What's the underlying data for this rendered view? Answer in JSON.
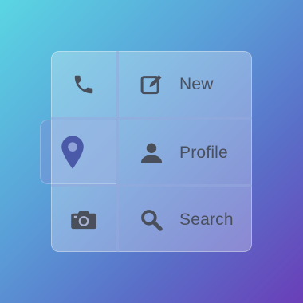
{
  "menu": {
    "items": [
      {
        "icon": "pencil-square-icon",
        "label": "New"
      },
      {
        "icon": "user-icon",
        "label": "Profile"
      },
      {
        "icon": "magnifier-icon",
        "label": "Search"
      }
    ],
    "side_icons": [
      "phone-icon",
      "map-pin-icon",
      "camera-icon"
    ],
    "active_side_index": 1
  },
  "colors": {
    "icon_gray": "#4a4f5c",
    "pin_blue": "#4b5aa8",
    "panel_tint": "rgba(255,255,255,0.28)"
  }
}
